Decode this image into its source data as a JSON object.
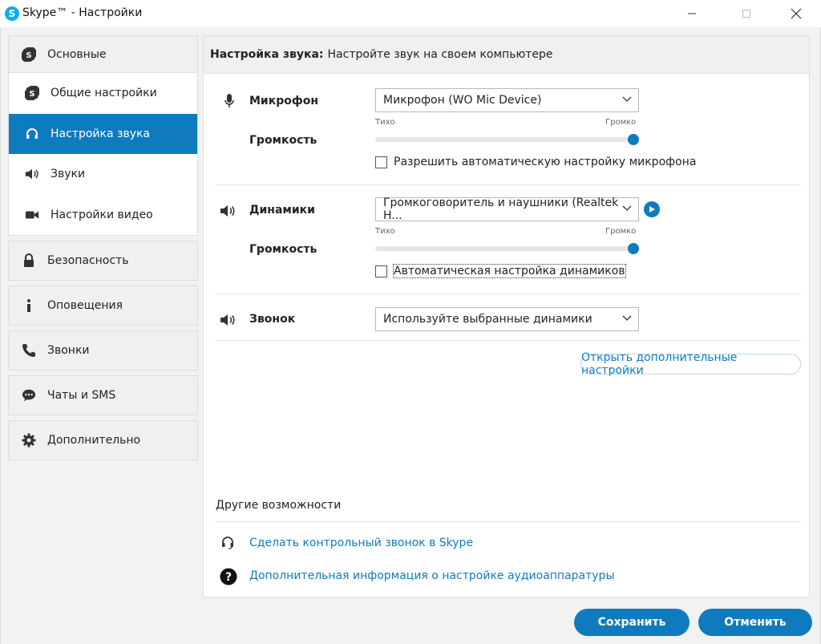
{
  "window": {
    "title": "Skype™ - Настройки",
    "logo_letter": "S"
  },
  "sidebar": {
    "main_group": {
      "label": "Основные",
      "items": [
        {
          "label": "Общие настройки",
          "icon": "skype-icon"
        },
        {
          "label": "Настройка звука",
          "icon": "headset-icon",
          "active": true
        },
        {
          "label": "Звуки",
          "icon": "speaker-icon"
        },
        {
          "label": "Настройки видео",
          "icon": "video-camera-icon"
        }
      ]
    },
    "items": [
      {
        "label": "Безопасность",
        "icon": "lock-icon"
      },
      {
        "label": "Оповещения",
        "icon": "info-icon"
      },
      {
        "label": "Звонки",
        "icon": "phone-icon"
      },
      {
        "label": "Чаты и SMS",
        "icon": "chat-icon"
      },
      {
        "label": "Дополнительно",
        "icon": "gear-icon"
      }
    ]
  },
  "content": {
    "header_bold": "Настройка звука:",
    "header_text": "Настройте звук на своем компьютере",
    "microphone": {
      "label": "Микрофон",
      "device": "Микрофон (WO Mic Device)",
      "volume_label": "Громкость",
      "quiet": "Тихо",
      "loud": "Громко",
      "volume_level": 1.0,
      "auto_label": "Разрешить автоматическую настройку микрофона",
      "auto_checked": false
    },
    "speakers": {
      "label": "Динамики",
      "device": "Громкоговоритель и наушники (Realtek H...",
      "volume_label": "Громкость",
      "quiet": "Тихо",
      "loud": "Громко",
      "volume_level": 1.0,
      "auto_label": "Автоматическая настройка динамиков",
      "auto_checked": false
    },
    "ringer": {
      "label": "Звонок",
      "device": "Используйте выбранные динамики"
    },
    "advanced_button": "Открыть дополнительные настройки",
    "other": {
      "title": "Другие возможности",
      "links": [
        {
          "label": "Сделать контрольный звонок в Skype",
          "icon": "headset-icon"
        },
        {
          "label": "Дополнительная информация о настройке аудиоаппаратуры",
          "icon": "question-icon"
        }
      ]
    }
  },
  "footer": {
    "save": "Сохранить",
    "cancel": "Отменить"
  },
  "colors": {
    "accent": "#0f7bbf",
    "skype_blue": "#00aff0"
  }
}
